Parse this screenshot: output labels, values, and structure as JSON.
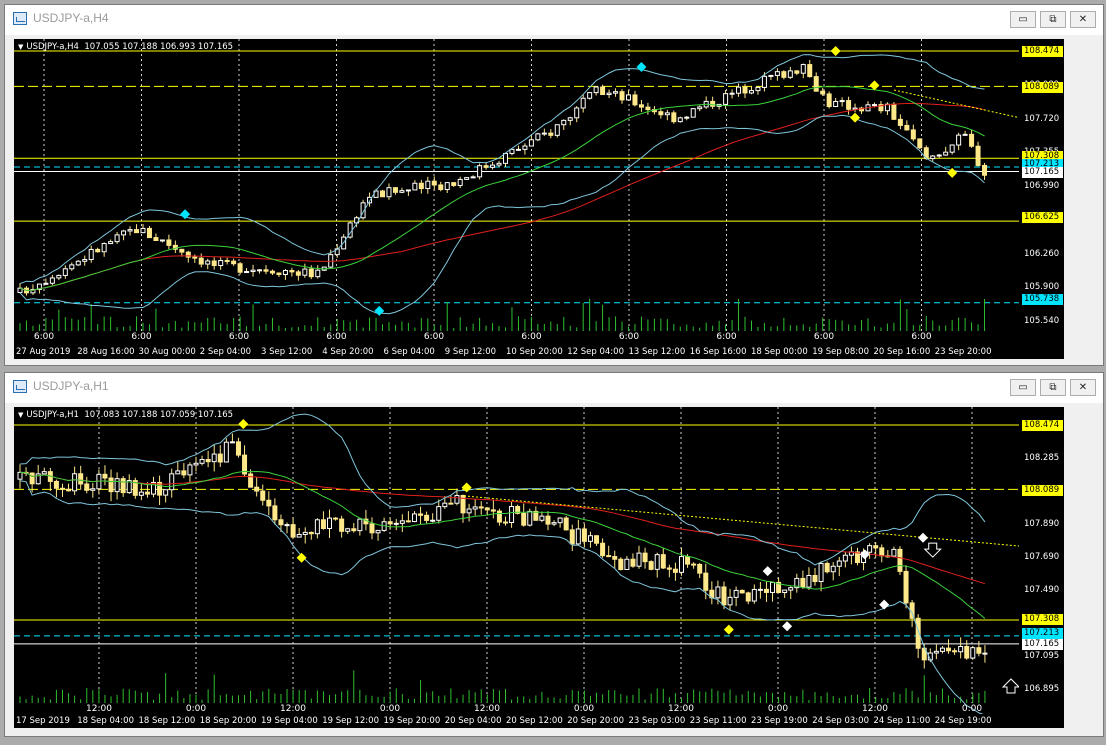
{
  "windows": [
    {
      "title": "USDJPY-a,H4",
      "header": {
        "symbol": "USDJPY-a,H4",
        "ohlc": "107.055 107.188 106.993 107.165"
      },
      "prices": [
        "108.460",
        "108.089",
        "107.720",
        "107.355",
        "106.990",
        "106.625",
        "106.260",
        "105.900",
        "105.540"
      ],
      "price_tags": [
        {
          "text": "108.474",
          "color": "yellow"
        },
        {
          "text": "108.089",
          "color": "yellow"
        },
        {
          "text": "107.308",
          "color": "yellow"
        },
        {
          "text": "107.213",
          "color": "cyan"
        },
        {
          "text": "107.165",
          "color": "white"
        },
        {
          "text": "106.625",
          "color": "yellow"
        },
        {
          "text": "105.738",
          "color": "cyan"
        }
      ],
      "sessions": [
        "6:00",
        "6:00",
        "6:00",
        "6:00",
        "6:00",
        "6:00",
        "6:00",
        "6:00",
        "6:00",
        "6:00"
      ],
      "dates": [
        "27 Aug 2019",
        "28 Aug 16:00",
        "30 Aug 00:00",
        "2 Sep 04:00",
        "3 Sep 12:00",
        "4 Sep 20:00",
        "6 Sep 04:00",
        "9 Sep 12:00",
        "10 Sep 20:00",
        "12 Sep 04:00",
        "13 Sep 12:00",
        "16 Sep 16:00",
        "18 Sep 00:00",
        "19 Sep 08:00",
        "20 Sep 16:00",
        "23 Sep 20:00"
      ]
    },
    {
      "title": "USDJPY-a,H1",
      "header": {
        "symbol": "USDJPY-a,H1",
        "ohlc": "107.083 107.188 107.059 107.165"
      },
      "prices": [
        "108.474",
        "108.285",
        "108.089",
        "107.890",
        "107.690",
        "107.490",
        "107.308",
        "107.095",
        "106.895"
      ],
      "price_tags": [
        {
          "text": "108.474",
          "color": "yellow"
        },
        {
          "text": "108.089",
          "color": "yellow"
        },
        {
          "text": "107.308",
          "color": "yellow"
        },
        {
          "text": "107.213",
          "color": "cyan"
        },
        {
          "text": "107.165",
          "color": "white"
        }
      ],
      "sessions": [
        "12:00",
        "0:00",
        "12:00",
        "0:00",
        "12:00",
        "0:00",
        "12:00",
        "0:00",
        "12:00",
        "0:00"
      ],
      "dates": [
        "17 Sep 2019",
        "18 Sep 04:00",
        "18 Sep 12:00",
        "18 Sep 20:00",
        "19 Sep 04:00",
        "19 Sep 12:00",
        "19 Sep 20:00",
        "20 Sep 04:00",
        "20 Sep 12:00",
        "20 Sep 20:00",
        "23 Sep 03:00",
        "23 Sep 11:00",
        "23 Sep 19:00",
        "24 Sep 03:00",
        "24 Sep 11:00",
        "24 Sep 19:00"
      ]
    }
  ],
  "colors": {
    "yellow": "#ffff00",
    "cyan": "#00e5ff",
    "white": "#ffffff",
    "candle_up": "#ffffff",
    "candle_down": "#ffe88a",
    "ma_red": "#e0201b",
    "ma_green": "#3bd23b",
    "bb": "#7fc6dc",
    "volume": "#2fbf2f"
  },
  "window_buttons": {
    "minimize": "▭",
    "restore": "⧉",
    "close": "✕"
  }
}
